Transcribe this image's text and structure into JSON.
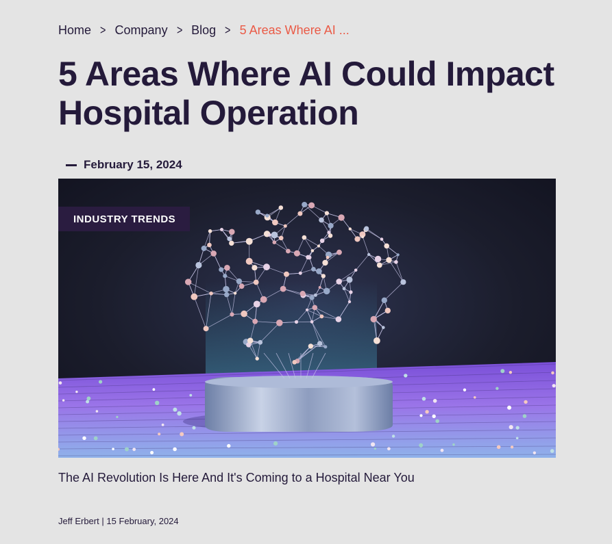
{
  "breadcrumb": {
    "items": [
      "Home",
      "Company",
      "Blog"
    ],
    "separator": ">",
    "current": "5 Areas Where AI ..."
  },
  "article": {
    "title": "5 Areas Where AI Could Impact Hospital Operation",
    "date": "February 15, 2024",
    "category": "INDUSTRY TRENDS",
    "subtitle": "The AI Revolution Is Here And It's Coming to a Hospital Near You",
    "author": "Jeff Erbert",
    "byline_separator": "|",
    "byline_date": "15 February, 2024"
  },
  "colors": {
    "background": "#e4e4e4",
    "text": "#241a3a",
    "breadcrumb_current": "#ea5a46",
    "badge_bg": "#2a1c40"
  },
  "icons": {
    "breadcrumb_separator": "chevron-right-icon",
    "date_marker": "dash-icon"
  }
}
